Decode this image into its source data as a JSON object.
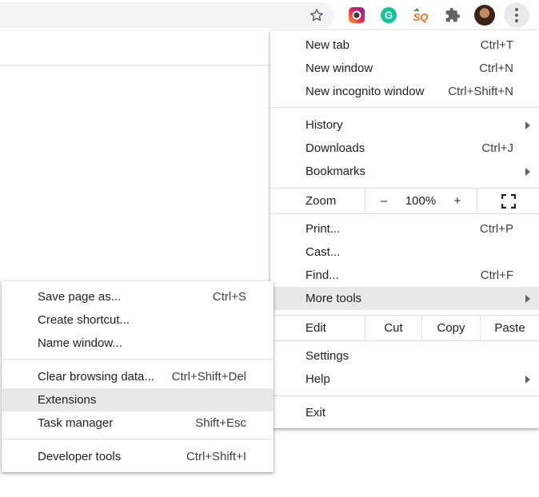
{
  "toolbar": {
    "icons": [
      "star-icon",
      "instagram-extension-icon",
      "grammarly-extension-icon",
      "sq-extension-icon",
      "extensions-puzzle-icon",
      "profile-avatar",
      "more-menu-icon"
    ],
    "sq_text": "SQ",
    "grammarly_text": "G"
  },
  "main_menu": {
    "new_tab": {
      "label": "New tab",
      "shortcut": "Ctrl+T"
    },
    "new_window": {
      "label": "New window",
      "shortcut": "Ctrl+N"
    },
    "new_incognito": {
      "label": "New incognito window",
      "shortcut": "Ctrl+Shift+N"
    },
    "history": {
      "label": "History"
    },
    "downloads": {
      "label": "Downloads",
      "shortcut": "Ctrl+J"
    },
    "bookmarks": {
      "label": "Bookmarks"
    },
    "zoom": {
      "label": "Zoom",
      "minus": "–",
      "value": "100%",
      "plus": "+"
    },
    "print": {
      "label": "Print...",
      "shortcut": "Ctrl+P"
    },
    "cast": {
      "label": "Cast..."
    },
    "find": {
      "label": "Find...",
      "shortcut": "Ctrl+F"
    },
    "more_tools": {
      "label": "More tools"
    },
    "edit": {
      "label": "Edit",
      "cut": "Cut",
      "copy": "Copy",
      "paste": "Paste"
    },
    "settings": {
      "label": "Settings"
    },
    "help": {
      "label": "Help"
    },
    "exit": {
      "label": "Exit"
    }
  },
  "sub_menu": {
    "save_page": {
      "label": "Save page as...",
      "shortcut": "Ctrl+S"
    },
    "create_shortcut": {
      "label": "Create shortcut..."
    },
    "name_window": {
      "label": "Name window..."
    },
    "clear_data": {
      "label": "Clear browsing data...",
      "shortcut": "Ctrl+Shift+Del"
    },
    "extensions": {
      "label": "Extensions"
    },
    "task_manager": {
      "label": "Task manager",
      "shortcut": "Shift+Esc"
    },
    "dev_tools": {
      "label": "Developer tools",
      "shortcut": "Ctrl+Shift+I"
    }
  },
  "colors": {
    "highlight": "#e8e8e8",
    "grammarly": "#15c39a",
    "sq_orange": "#f26b1d",
    "sq_green": "#2e9e3f"
  }
}
